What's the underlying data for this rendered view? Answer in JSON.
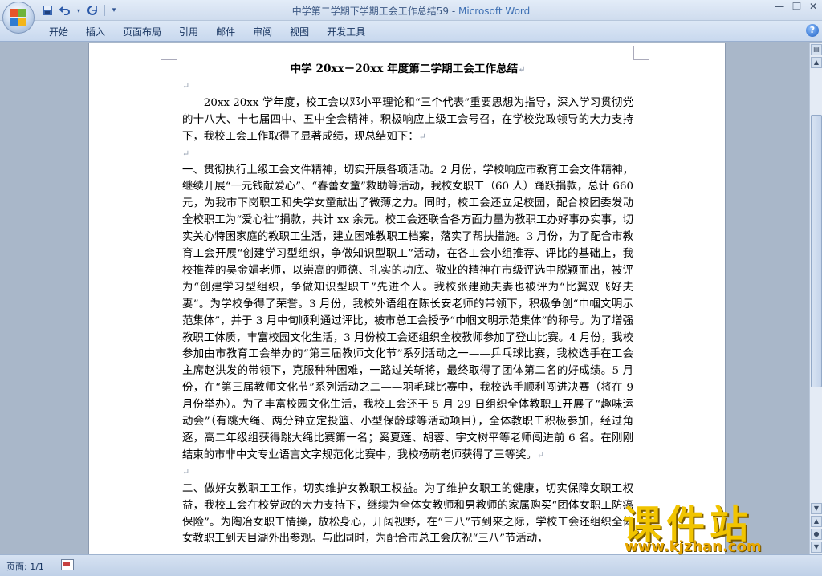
{
  "window": {
    "title_doc": "中学第二学期下学期工会工作总结59",
    "title_sep": " - ",
    "title_app": "Microsoft Word"
  },
  "quick_access": {
    "save_icon": "save-icon",
    "undo_icon": "undo-icon",
    "redo_icon": "redo-icon",
    "customize_icon": "customize-arrow-icon"
  },
  "ribbon": {
    "tabs": [
      "开始",
      "插入",
      "页面布局",
      "引用",
      "邮件",
      "审阅",
      "视图",
      "开发工具"
    ]
  },
  "document": {
    "title": "中学 20xx－20xx 年度第二学期工会工作总结",
    "paragraphs": [
      "20xx-20xx 学年度，校工会以邓小平理论和“三个代表”重要思想为指导，深入学习贯彻党的十八大、十七届四中、五中全会精神，积极响应上级工会号召，在学校党政领导的大力支持下，我校工会工作取得了显著成绩，现总结如下：",
      "一、贯彻执行上级工会文件精神，切实开展各项活动。2 月份，学校响应市教育工会文件精神，继续开展“一元钱献爱心”、“春蕾女童”救助等活动，我校女职工（60 人）踊跃捐款，总计 660 元，为我市下岗职工和失学女童献出了微薄之力。同时，校工会还立足校园，配合校团委发动全校职工为“爱心社”捐款，共计 xx 余元。校工会还联合各方面力量为教职工办好事办实事，切实关心特困家庭的教职工生活，建立困难教职工档案，落实了帮扶措施。3 月份，为了配合市教育工会开展“创建学习型组织，争做知识型职工”活动，在各工会小组推荐、评比的基础上，我校推荐的吴金娟老师，以崇高的师德、扎实的功底、敬业的精神在市级评选中脱颖而出，被评为“创建学习型组织，争做知识型职工”先进个人。我校张建勋夫妻也被评为“比翼双飞好夫妻”。为学校争得了荣誉。3 月份，我校外语组在陈长安老师的带领下，积极争创“巾帼文明示范集体”，并于 3 月中旬顺利通过评比，被市总工会授予“巾帼文明示范集体”的称号。为了增强教职工体质，丰富校园文化生活，3 月份校工会还组织全校教师参加了登山比赛。4 月份，我校参加由市教育工会举办的“第三届教师文化节”系列活动之一——乒乓球比赛，我校选手在工会主席赵洪发的带领下，克服种种困难，一路过关斩将，最终取得了团体第二名的好成绩。5 月份，在“第三届教师文化节”系列活动之二——羽毛球比赛中，我校选手顺利闯进决赛（将在 9 月份举办）。为了丰富校园文化生活，我校工会还于 5 月 29 日组织全体教职工开展了“趣味运动会”（有跳大绳、两分钟立定投篮、小型保龄球等活动项目），全体教职工积极参加，经过角逐，高二年级组获得跳大绳比赛第一名；奚夏莲、胡蓉、宇文树平等老师闯进前 6 名。在刚刚结束的市非中文专业语言文字规范化比赛中，我校杨萌老师获得了三等奖。",
      "二、做好女教职工工作，切实维护女教职工权益。为了维护女职工的健康，切实保障女职工权益，我校工会在校党政的大力支持下，继续为全体女教师和男教师的家属购买“团体女职工防癌保险”。为陶冶女职工情操，放松身心，开阔视野，在“三八”节到来之际，学校工会还组织全体女教职工到天目湖外出参观。与此同时，为配合市总工会庆祝“三八”节活动，"
    ],
    "para_mark": "↵"
  },
  "statusbar": {
    "page_label": "页面: 1/1"
  },
  "watermark": {
    "brand": "课件站",
    "url": "www.kjzhan.com"
  }
}
